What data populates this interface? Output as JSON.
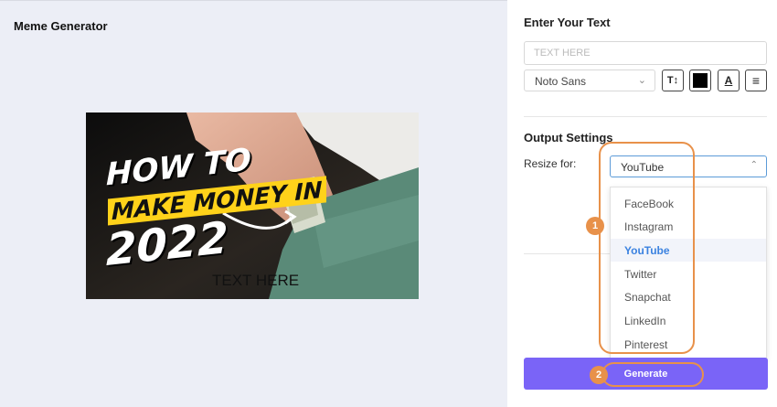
{
  "app": {
    "title": "Meme Generator"
  },
  "preview": {
    "line1": "HOW TO",
    "line2": "MAKE MONEY IN",
    "line3": "2022",
    "overlay_text": "TEXT HERE"
  },
  "text_section": {
    "heading": "Enter Your Text",
    "input_placeholder": "TEXT HERE",
    "font_value": "Noto Sans",
    "tools": [
      {
        "icon": "text-size-icon",
        "glyph": "T↕"
      },
      {
        "icon": "color-swatch-icon",
        "color": "#000000"
      },
      {
        "icon": "text-underline-icon",
        "glyph": "A"
      },
      {
        "icon": "align-icon",
        "glyph": "≡"
      }
    ]
  },
  "output_section": {
    "heading": "Output Settings",
    "resize_label": "Resize for:",
    "resize_value": "YouTube",
    "options": [
      "FaceBook",
      "Instagram",
      "YouTube",
      "Twitter",
      "Snapchat",
      "LinkedIn",
      "Pinterest"
    ],
    "selected_option": "YouTube"
  },
  "generate_label": "Generate",
  "annotations": {
    "badge_1": "1",
    "badge_2": "2",
    "color": "#e8914a"
  },
  "colors": {
    "accent": "#7a64f7",
    "selected_text": "#3b82e0",
    "left_bg": "#eceef6"
  }
}
